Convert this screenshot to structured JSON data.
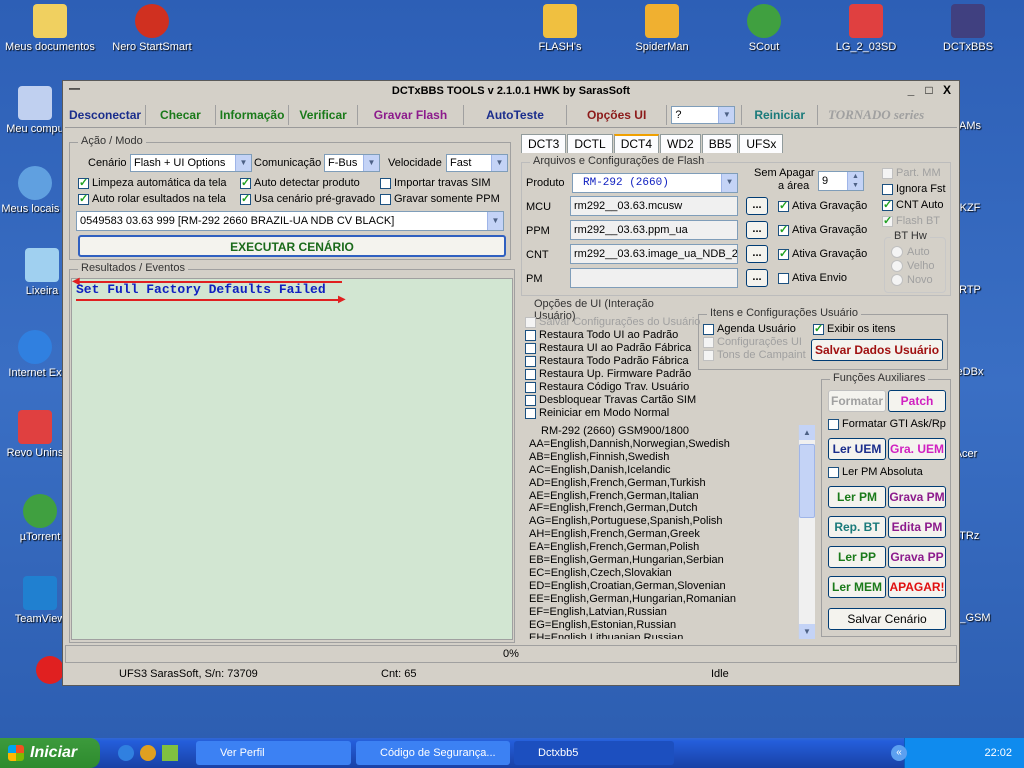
{
  "desktop": {
    "icons": [
      {
        "label": "Meus documentos",
        "color": "#f0d060"
      },
      {
        "label": "Nero StartSmart",
        "color": "#d03020"
      },
      {
        "label": "FLASH's",
        "color": "#f0c040"
      },
      {
        "label": "SpiderMan",
        "color": "#f0b030"
      },
      {
        "label": "SCout",
        "color": "#40a040"
      },
      {
        "label": "LG_2_03SD",
        "color": "#e04040"
      },
      {
        "label": "DCTxBBS",
        "color": "#404080"
      },
      {
        "label": "Meu compu",
        "color": "#c0d0f0"
      },
      {
        "label": "Meus locais d",
        "color": "#60a0e0"
      },
      {
        "label": "Lixeira",
        "color": "#a0d0f0"
      },
      {
        "label": "Internet Ex",
        "color": "#3080e0"
      },
      {
        "label": "Revo Unins",
        "color": "#e04040"
      },
      {
        "label": "µTorrent",
        "color": "#40a040"
      },
      {
        "label": "TeamView",
        "color": "#2080d0"
      },
      {
        "label": "AMs",
        "color": "#404080"
      },
      {
        "label": "KZF",
        "color": "#404080"
      },
      {
        "label": "RTP",
        "color": "#404080"
      },
      {
        "label": "eDBx",
        "color": "#404080"
      },
      {
        "label": "Acer",
        "color": "#404080"
      },
      {
        "label": "ATRz",
        "color": "#404080"
      },
      {
        "label": "_GSM",
        "color": "#404080"
      }
    ]
  },
  "window": {
    "title": "DCTxBBS TOOLS v 2.1.0.1 HWK by SarasSoft",
    "controls": {
      "minimize": "_",
      "maximize": "□",
      "close": "X"
    },
    "sysmenu": "—"
  },
  "toolbar": {
    "items": [
      {
        "label": "Desconectar",
        "color": "#1a2d8c"
      },
      {
        "label": "Checar",
        "color": "#1a7a1a"
      },
      {
        "label": "Informação",
        "color": "#1a7a1a"
      },
      {
        "label": "Verificar",
        "color": "#1a7a1a"
      },
      {
        "label": "Gravar Flash",
        "color": "#8c1a8c"
      },
      {
        "label": "AutoTeste",
        "color": "#1a2d8c"
      },
      {
        "label": "Opções UI",
        "color": "#8c1a1a"
      }
    ],
    "help_select": "?",
    "reiniciar": "Reiniciar",
    "tornado": "TORNADO series"
  },
  "acao": {
    "group_label": "Ação / Modo",
    "cenario_label": "Cenário",
    "cenario_value": "Flash + UI Options",
    "comunicacao_label": "Comunicação",
    "comunicacao_value": "F-Bus",
    "velocidade_label": "Velocidade",
    "velocidade_value": "Fast",
    "checks": {
      "limpeza": "Limpeza automática da tela",
      "auto_detectar": "Auto detectar produto",
      "importar": "Importar travas SIM",
      "auto_rolar": "Auto rolar esultados na tela",
      "usa_cenario": "Usa cenário pré-gravado",
      "gravar_somente": "Gravar somente PPM"
    },
    "firmware_select": "0549583 03.63 999  [RM-292 2660 BRAZIL-UA NDB CV BLACK]",
    "executar": "EXECUTAR CENÁRIO"
  },
  "results": {
    "group_label": "Resultados / Eventos",
    "message": "Set Full Factory Defaults Failed"
  },
  "tabs": [
    "DCT3",
    "DCTL",
    "DCT4",
    "WD2",
    "BB5",
    "UFSx"
  ],
  "active_tab": "DCT4",
  "flash": {
    "group_label": "Arquivos e Configurações de Flash",
    "produto_label": "Produto",
    "produto_value": "RM-292  (2660)",
    "sem_apagar_label": "Sem Apagar",
    "a_area_label": "a área",
    "sem_apagar_value": "9",
    "rows": [
      {
        "label": "MCU",
        "file": "rm292__03.63.mcusw",
        "check": "Ativa Gravação",
        "checked": true
      },
      {
        "label": "PPM",
        "file": "rm292__03.63.ppm_ua",
        "check": "Ativa Gravação",
        "checked": true
      },
      {
        "label": "CNT",
        "file": "rm292__03.63.image_ua_NDB_2",
        "check": "Ativa Gravação",
        "checked": true
      },
      {
        "label": "PM",
        "file": "",
        "check": "Ativa Envio",
        "checked": false
      }
    ],
    "browse": "...",
    "side": {
      "part_mm": "Part. MM",
      "ignora_fst": "Ignora Fst",
      "cnt_auto": "CNT Auto",
      "flash_bt": "Flash BT"
    },
    "bt_hw": {
      "label": "BT Hw",
      "options": [
        "Auto",
        "Velho",
        "Novo"
      ]
    }
  },
  "opcoes_ui": {
    "group_label": "Opções de UI (Interação Usuário)",
    "items": [
      {
        "label": "Salvar Configurações do Usuário",
        "disabled": true
      },
      {
        "label": "Restaura Todo UI ao Padrão",
        "disabled": false
      },
      {
        "label": "Restaura UI ao Padrão Fábrica",
        "disabled": false
      },
      {
        "label": "Restaura Todo Padrão Fábrica",
        "disabled": false
      },
      {
        "label": "Restaura Up. Firmware Padrão",
        "disabled": false
      },
      {
        "label": "Restaura Código Trav. Usuário",
        "disabled": false
      },
      {
        "label": "Desbloquear Travas Cartão SIM",
        "disabled": false
      },
      {
        "label": "Reiniciar em Modo Normal",
        "disabled": false
      }
    ]
  },
  "itens": {
    "group_label": "Itens e Configurações Usuário",
    "agenda": "Agenda Usuário",
    "configuracoes": "Configurações UI",
    "tons": "Tons de Campaint",
    "exibir": "Exibir os itens",
    "salvar": "Salvar Dados Usuário"
  },
  "languages": {
    "header": "RM-292 (2660) GSM900/1800",
    "items": [
      "AA=English,Dannish,Norwegian,Swedish",
      "AB=English,Finnish,Swedish",
      "AC=English,Danish,Icelandic",
      "AD=English,French,German,Turkish",
      "AE=English,French,German,Italian",
      "AF=English,French,German,Dutch",
      "AG=English,Portuguese,Spanish,Polish",
      "AH=English,French,German,Greek",
      "EA=English,French,German,Polish",
      "EB=English,German,Hungarian,Serbian",
      "EC=English,Czech,Slovakian",
      "ED=English,Croatian,German,Slovenian",
      "EE=English,German,Hungarian,Romanian",
      "EF=English,Latvian,Russian",
      "EG=English,Estonian,Russian",
      "EH=English,Lithuanian,Russian"
    ]
  },
  "funcoes": {
    "group_label": "Funções Auxiliares",
    "formatar": "Formatar",
    "patch": "Patch",
    "formatar_gti": "Formatar GTI Ask/Rp",
    "ler_uem": "Ler UEM",
    "gra_uem": "Gra. UEM",
    "ler_pm_absoluta": "Ler PM Absoluta",
    "ler_pm": "Ler PM",
    "grava_pm": "Grava PM",
    "rep_bt": "Rep. BT",
    "edita_pm": "Edita PM",
    "ler_pp": "Ler PP",
    "grava_pp": "Grava PP",
    "ler_mem": "Ler MEM",
    "apagar": "APAGAR!",
    "salvar_cenario": "Salvar Cenário"
  },
  "progress": {
    "value": 0,
    "label": "0%"
  },
  "status": {
    "left": "UFS3 SarasSoft, S/n: 73709",
    "cnt": "Cnt: 65",
    "state": "Idle"
  },
  "taskbar": {
    "start": "Iniciar",
    "tasks": [
      "Ver Perfil",
      "Código de Segurança...",
      "Dctxbb5"
    ],
    "clock": "22:02"
  }
}
